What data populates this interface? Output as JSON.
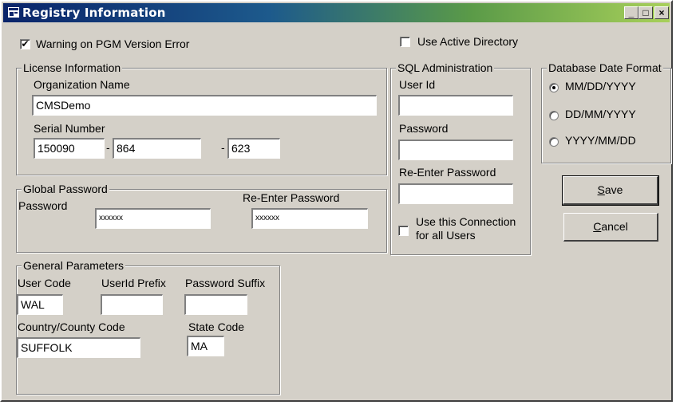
{
  "window": {
    "title": "Registry Information",
    "controls": [
      "_",
      "□",
      "×"
    ]
  },
  "options": {
    "warning_pgm": {
      "label": "Warning on PGM Version Error",
      "checked": true
    },
    "use_active_directory": {
      "label": "Use Active Directory",
      "checked": false
    }
  },
  "license": {
    "title": "License Information",
    "org_label": "Organization Name",
    "org_value": "CMSDemo",
    "serial_label": "Serial Number",
    "serial": [
      "150090",
      "864",
      "623"
    ],
    "dash": "-"
  },
  "global_password": {
    "title": "Global Password",
    "password_label": "Password",
    "password_value": "xxxxxx",
    "reenter_label": "Re-Enter Password",
    "reenter_value": "xxxxxx"
  },
  "general": {
    "title": "General Parameters",
    "user_code_label": "User Code",
    "user_code_value": "WAL",
    "userid_prefix_label": "UserId Prefix",
    "userid_prefix_value": "",
    "password_suffix_label": "Password Suffix",
    "password_suffix_value": "",
    "country_label": "Country/County Code",
    "country_value": "SUFFOLK",
    "state_label": "State Code",
    "state_value": "MA"
  },
  "sql": {
    "title": "SQL Administration",
    "userid_label": "User Id",
    "userid_value": "",
    "password_label": "Password",
    "password_value": "",
    "reenter_label": "Re-Enter Password",
    "reenter_value": "",
    "use_connection_line1": "Use this Connection",
    "use_connection_line2": "for all Users",
    "use_connection_checked": false
  },
  "date_format": {
    "title": "Database Date Format",
    "options": [
      {
        "label": "MM/DD/YYYY",
        "selected": true
      },
      {
        "label": "DD/MM/YYYY",
        "selected": false
      },
      {
        "label": "YYYY/MM/DD",
        "selected": false
      }
    ]
  },
  "buttons": {
    "save_mnemonic": "S",
    "save_rest": "ave",
    "cancel_mnemonic": "C",
    "cancel_rest": "ancel"
  }
}
